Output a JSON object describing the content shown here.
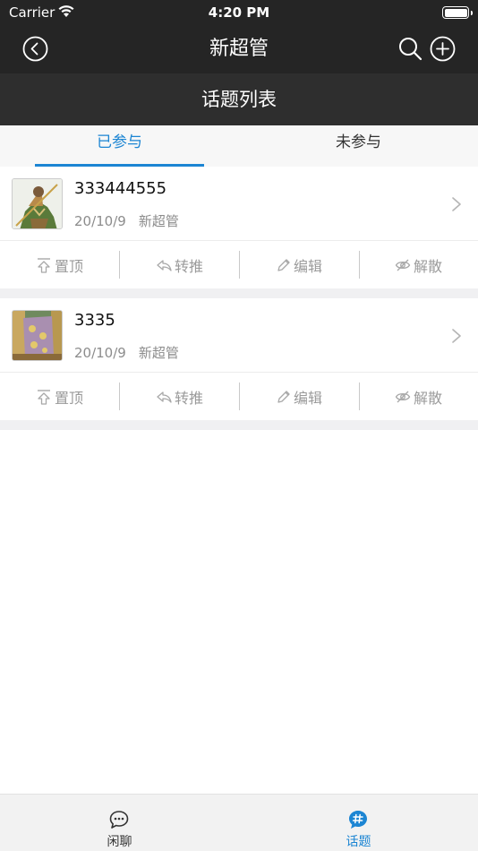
{
  "status_bar": {
    "carrier": "Carrier",
    "time": "4:20 PM"
  },
  "nav": {
    "title": "新超管",
    "icons": [
      "back-icon",
      "search-icon",
      "add-icon"
    ]
  },
  "subheader": {
    "title": "话题列表"
  },
  "tabs": {
    "items": [
      {
        "label": "已参与",
        "active": true
      },
      {
        "label": "未参与",
        "active": false
      }
    ]
  },
  "topics": [
    {
      "title": "333444555",
      "date": "20/10/9",
      "author": "新超管",
      "actions": [
        "置顶",
        "转推",
        "编辑",
        "解散"
      ]
    },
    {
      "title": "3335",
      "date": "20/10/9",
      "author": "新超管",
      "actions": [
        "置顶",
        "转推",
        "编辑",
        "解散"
      ]
    }
  ],
  "tabbar": {
    "items": [
      {
        "label": "闲聊",
        "icon": "chat-icon"
      },
      {
        "label": "话题",
        "icon": "hashtag-icon",
        "active": true
      }
    ]
  },
  "colors": {
    "accent": "#1c85d3",
    "nav_bg": "#252525",
    "subheader_bg": "#2e2e2e"
  }
}
